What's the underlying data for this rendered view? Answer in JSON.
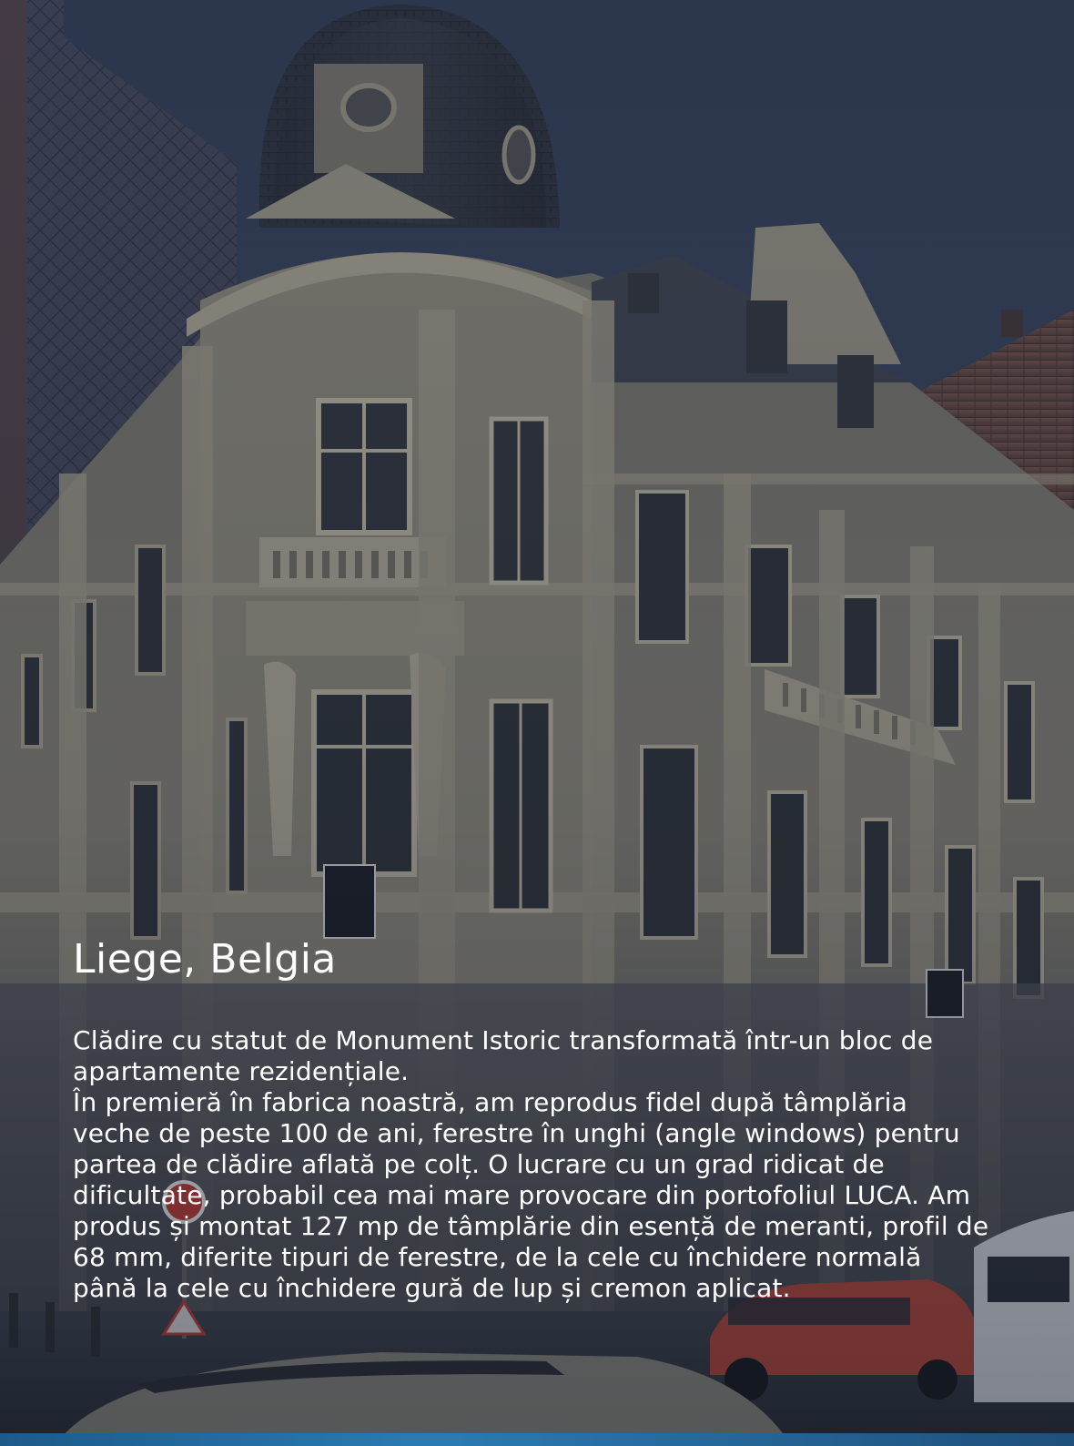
{
  "hero": {
    "title": "Liege, Belgia",
    "paragraphs": [
      "Clădire cu statut de Monument Istoric transformată într-un bloc de apartamente rezidențiale.",
      "În premieră în fabrica noastră, am reprodus fidel după tâmplăria veche de peste 100 de ani, ferestre în unghi (angle windows) pentru partea de clădire aflată pe colț. O lucrare cu un grad ridicat de dificultate, probabil cea mai mare provocare din portofoliul LUCA. Am produs și montat 127 mp de tâmplărie din esență de meranti, profil de 68 mm, diferite tipuri de ferestre, de la cele cu închidere normală până la cele cu închidere gură de lup și cremon aplicat."
    ]
  },
  "colors": {
    "text": "#ffffff",
    "sky": "#3a4560",
    "facade": "#8a8474",
    "bottom_strip": "#2b7bb3"
  }
}
